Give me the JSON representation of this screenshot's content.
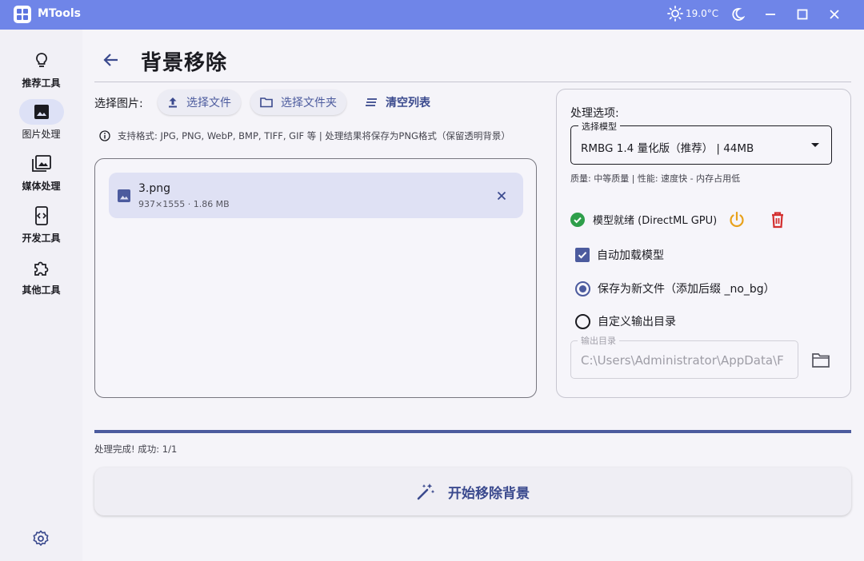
{
  "app": {
    "title": "MTools",
    "temperature": "19.0°C"
  },
  "sidebar": {
    "items": [
      {
        "label": "推荐工具",
        "icon": "lightbulb-icon"
      },
      {
        "label": "图片处理",
        "icon": "image-icon",
        "active": true
      },
      {
        "label": "媒体处理",
        "icon": "media-library-icon"
      },
      {
        "label": "开发工具",
        "icon": "code-icon"
      },
      {
        "label": "其他工具",
        "icon": "puzzle-icon"
      }
    ]
  },
  "page": {
    "title": "背景移除"
  },
  "toolbar": {
    "select_label": "选择图片:",
    "select_file": "选择文件",
    "select_folder": "选择文件夹",
    "clear_list": "清空列表"
  },
  "info": "支持格式: JPG, PNG, WebP, BMP, TIFF, GIF 等 | 处理结果将保存为PNG格式（保留透明背景）",
  "files": [
    {
      "name": "3.png",
      "meta": "937×1555 · 1.86 MB"
    }
  ],
  "options": {
    "title": "处理选项:",
    "model_legend": "选择模型",
    "model_value": "RMBG 1.4 量化版（推荐） | 44MB",
    "model_desc": "质量: 中等质量 | 性能: 速度快 - 内存占用低",
    "status": "模型就绪 (DirectML GPU)",
    "auto_load_label": "自动加载模型",
    "auto_load_checked": true,
    "save_new_label": "保存为新文件（添加后缀 _no_bg）",
    "custom_dir_label": "自定义输出目录",
    "selected_output": "save_new",
    "outdir_legend": "输出目录",
    "outdir_value": "C:\\Users\\Administrator\\AppData\\F"
  },
  "progress": {
    "fraction": 1.0,
    "text": "处理完成! 成功: 1/1"
  },
  "start_button": "开始移除背景",
  "colors": {
    "titlebar": "#6f85e8",
    "accent": "#4c5b9e",
    "success": "#2e9e4a",
    "warning": "#e8a21c",
    "danger": "#d32f2f"
  }
}
